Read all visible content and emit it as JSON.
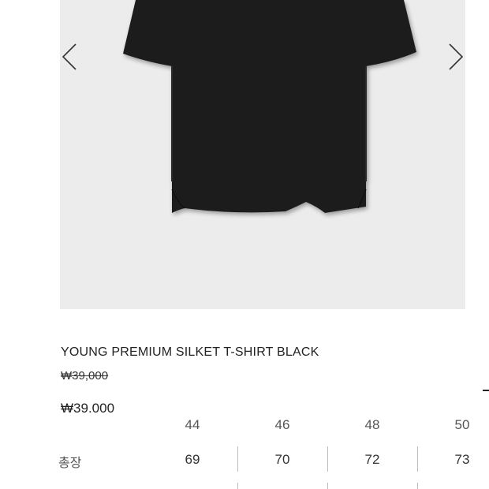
{
  "product": {
    "title": "YOUNG PREMIUM SILKET T-SHIRT BLACK",
    "original_price": "₩39,000",
    "sale_price": "₩39.000",
    "image_background": "#ececec",
    "shirt_color": "#1e1e1e"
  },
  "gallery": {
    "prev_icon": "chevron-left-icon",
    "next_icon": "chevron-right-icon"
  },
  "size_table": {
    "sizes": [
      "44",
      "46",
      "48",
      "50"
    ],
    "rows": [
      {
        "label": "총장",
        "values": [
          "69",
          "70",
          "72",
          "73"
        ]
      }
    ]
  }
}
